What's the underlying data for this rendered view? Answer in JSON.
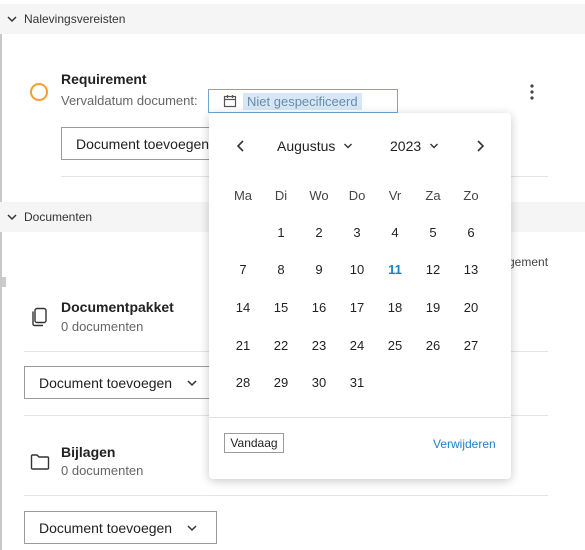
{
  "sections": {
    "compliance": {
      "title": "Nalevingsvereisten"
    },
    "documents": {
      "title": "Documenten",
      "clipped_text": "gement"
    }
  },
  "requirement": {
    "title": "Requirement",
    "due_label": "Vervaldatum document:",
    "due_placeholder": "Niet gespecificeerd",
    "add_document_label": "Document toevoegen"
  },
  "document_package": {
    "title": "Documentpakket",
    "count": "0 documenten",
    "add_document_label": "Document toevoegen"
  },
  "attachments": {
    "title": "Bijlagen",
    "count": "0 documenten",
    "add_document_label": "Document toevoegen"
  },
  "datepicker": {
    "month": "Augustus",
    "year": "2023",
    "weekdays": [
      "Ma",
      "Di",
      "Wo",
      "Do",
      "Vr",
      "Za",
      "Zo"
    ],
    "weeks": [
      [
        "",
        "1",
        "2",
        "3",
        "4",
        "5",
        "6"
      ],
      [
        "7",
        "8",
        "9",
        "10",
        "11",
        "12",
        "13"
      ],
      [
        "14",
        "15",
        "16",
        "17",
        "18",
        "19",
        "20"
      ],
      [
        "21",
        "22",
        "23",
        "24",
        "25",
        "26",
        "27"
      ],
      [
        "28",
        "29",
        "30",
        "31",
        "",
        "",
        ""
      ]
    ],
    "today": "11",
    "today_label": "Vandaag",
    "remove_label": "Verwijderen"
  },
  "colors": {
    "accent": "#1b82c5",
    "status_ring": "#f0a030"
  }
}
